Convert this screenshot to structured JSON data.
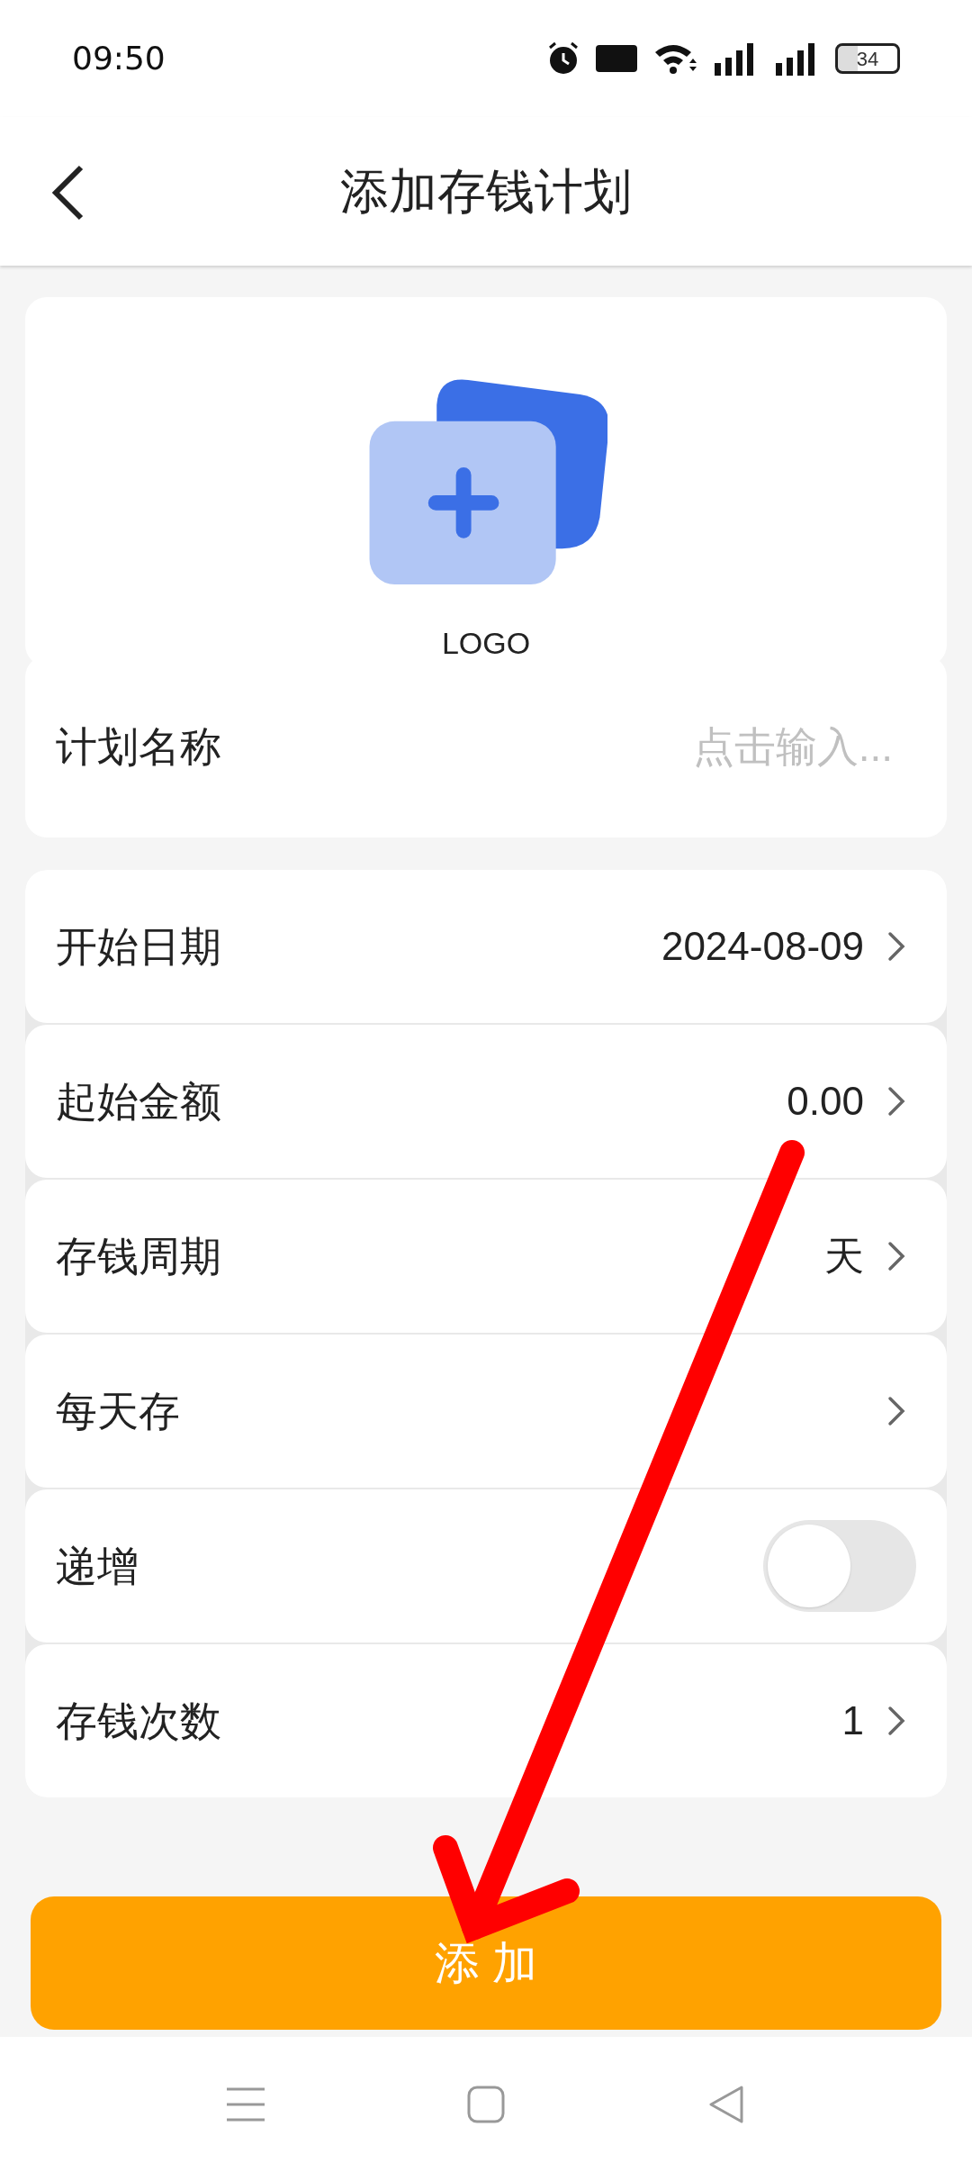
{
  "status_bar": {
    "time": "09:50",
    "battery": "34"
  },
  "header": {
    "title": "添加存钱计划"
  },
  "logo": {
    "label": "LOGO"
  },
  "name_field": {
    "label": "计划名称",
    "placeholder": "点击输入..."
  },
  "rows": [
    {
      "kind": "value",
      "label": "开始日期",
      "value": "2024-08-09"
    },
    {
      "kind": "value",
      "label": "起始金额",
      "value": "0.00"
    },
    {
      "kind": "value",
      "label": "存钱周期",
      "value": "天"
    },
    {
      "kind": "value",
      "label": "每天存"
    },
    {
      "kind": "toggle",
      "label": "递增",
      "on": false
    },
    {
      "kind": "value",
      "label": "存钱次数",
      "value": "1"
    }
  ],
  "submit_button": {
    "label": "添 加"
  }
}
